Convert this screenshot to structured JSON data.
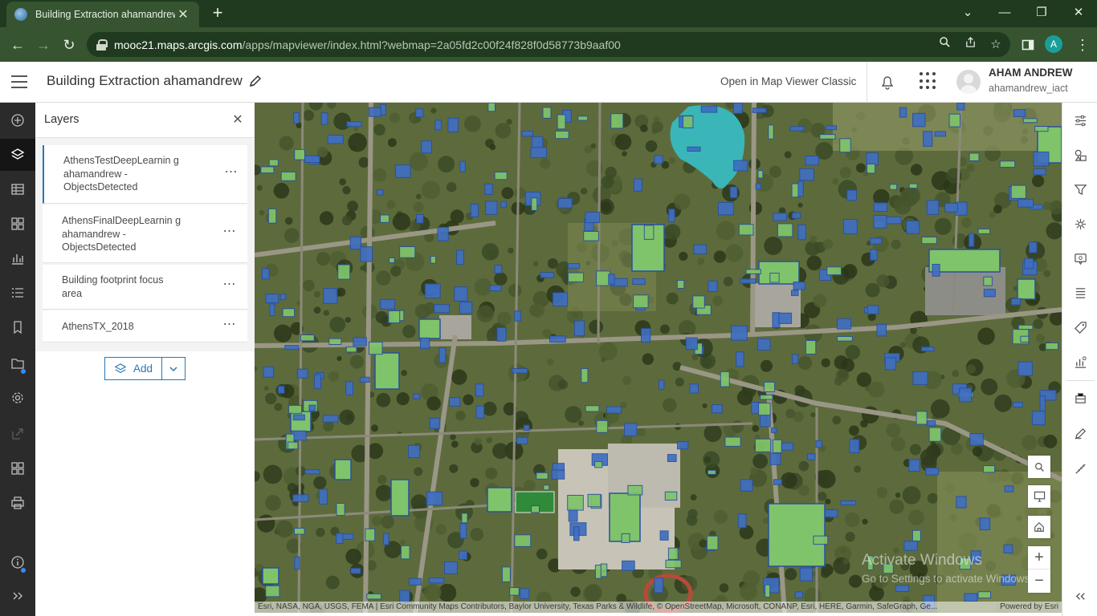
{
  "browser": {
    "tab_title": "Building Extraction ahamandrew",
    "tab_favicon": "arcgis-globe-icon",
    "new_tab": "+",
    "url_host": "mooc21.maps.arcgis.com",
    "url_path": "/apps/mapviewer/index.html?webmap=2a05fd2c00f24f828f0d58773b9aaf00",
    "profile_initial": "A",
    "colors": {
      "frame": "#1f3a1f",
      "toolbar": "#35542f",
      "profile": "#1a9e9a"
    }
  },
  "header": {
    "title": "Building Extraction ahamandrew",
    "open_classic": "Open in Map Viewer Classic",
    "user_name": "AHAM ANDREW",
    "user_id": "ahamandrew_iact"
  },
  "panel": {
    "title": "Layers",
    "layers": [
      {
        "label": "AthensTestDeepLearnin g ahamandrew - ObjectsDetected",
        "selected": true
      },
      {
        "label": "AthensFinalDeepLearnin g ahamandrew - ObjectsDetected",
        "selected": false
      },
      {
        "label": "Building footprint focus area",
        "selected": false
      },
      {
        "label": "AthensTX_2018",
        "selected": false
      }
    ],
    "menu_glyph": "⋯",
    "add_label": "Add"
  },
  "map": {
    "attribution": "Esri, NASA, NGA, USGS, FEMA | Esri Community Maps Contributors, Baylor University, Texas Parks & Wildlife, © OpenStreetMap, Microsoft, CONANP, Esri, HERE, Garmin, SafeGraph, Ge...",
    "powered_by": "Powered by Esri",
    "watermark_title": "Activate Windows",
    "watermark_sub": "Go to Settings to activate Windows.",
    "zoom_in": "+",
    "zoom_out": "−",
    "colors": {
      "imagery": "#5d6b3c",
      "building_green": "#7fc46a",
      "building_blue": "#3f6fc0",
      "lake": "#3bb6b8"
    }
  }
}
